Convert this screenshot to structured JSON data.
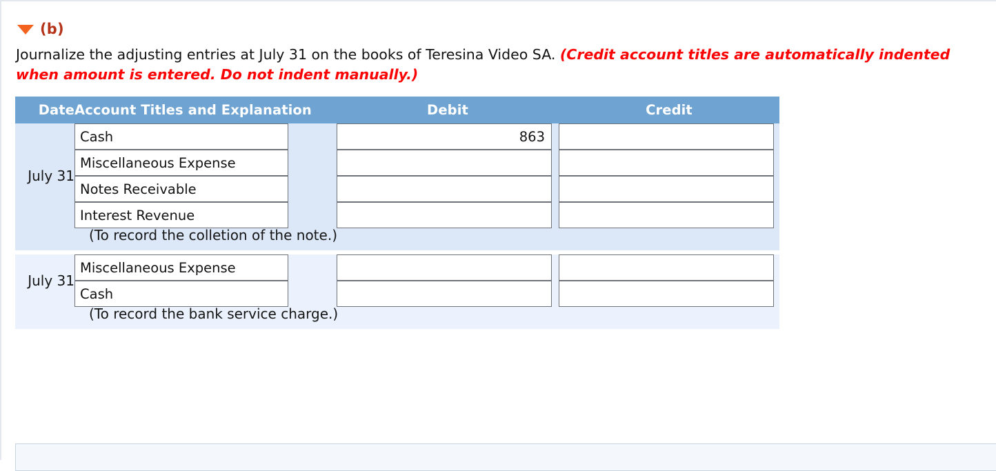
{
  "part": {
    "toggle_icon": "triangle-down-icon",
    "label": "(b)"
  },
  "instructions": {
    "plain": "Journalize the adjusting entries at July 31 on the books of Teresina Video SA.",
    "emphasis": "(Credit account titles are automatically indented when amount is entered. Do not indent manually.)"
  },
  "table": {
    "headers": {
      "date": "Date",
      "account": "Account Titles and Explanation",
      "debit": "Debit",
      "credit": "Credit"
    },
    "entries": [
      {
        "date": "July 31",
        "lines": [
          {
            "account": "Cash",
            "debit": "863",
            "credit": ""
          },
          {
            "account": "Miscellaneous Expense",
            "debit": "",
            "credit": ""
          },
          {
            "account": "Notes Receivable",
            "debit": "",
            "credit": ""
          },
          {
            "account": "Interest Revenue",
            "debit": "",
            "credit": ""
          }
        ],
        "memo": "(To record the colletion of the note.)"
      },
      {
        "date": "July 31",
        "lines": [
          {
            "account": "Miscellaneous Expense",
            "debit": "",
            "credit": ""
          },
          {
            "account": "Cash",
            "debit": "",
            "credit": ""
          }
        ],
        "memo": "(To record the bank service charge.)"
      }
    ]
  },
  "colors": {
    "header_band": "#6fa3d2",
    "block_a_bg": "#dce8f8",
    "block_b_bg": "#ebf2fd",
    "accent_orange": "#f4621f",
    "part_label": "#b53318",
    "emphasis_red": "#fa0505"
  }
}
